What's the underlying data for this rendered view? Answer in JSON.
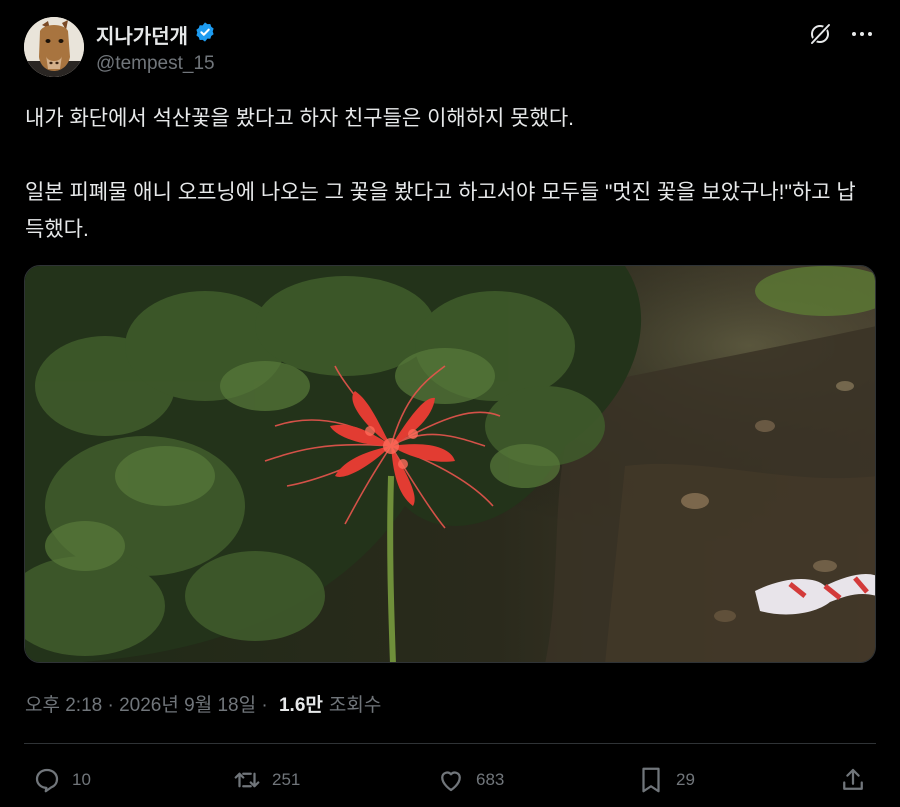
{
  "author": {
    "display_name": "지나가던개",
    "handle": "@tempest_15",
    "verified": true,
    "verified_color": "#1d9bf0"
  },
  "header_icons": [
    "grok-icon",
    "more-icon"
  ],
  "tweet": {
    "text": "내가 화단에서 석산꽃을 봤다고 하자 친구들은 이해하지 못했다.\n\n일본 피폐물 애니 오프닝에 나오는 그 꽃을 봤다고 하고서야 모두들 \"멋진 꽃을 보았구나!\"하고 납득했다."
  },
  "meta": {
    "timestamp": "오후 2:18 · 2026년 9월 18일 · ",
    "views_count": "1.6만",
    "views_label": "조회수"
  },
  "actions": {
    "replies": "10",
    "reposts": "251",
    "likes": "683",
    "bookmarks": "29"
  },
  "colors": {
    "background": "#000000",
    "text": "#e7e9ea",
    "muted": "#71767b",
    "border": "#2f3336"
  }
}
